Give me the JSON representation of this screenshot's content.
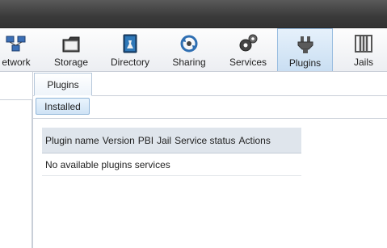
{
  "toolbar": {
    "items": [
      {
        "label": "etwork",
        "icon": "network-icon"
      },
      {
        "label": "Storage",
        "icon": "storage-icon"
      },
      {
        "label": "Directory",
        "icon": "directory-icon"
      },
      {
        "label": "Sharing",
        "icon": "sharing-icon"
      },
      {
        "label": "Services",
        "icon": "services-icon"
      },
      {
        "label": "Plugins",
        "icon": "plugins-icon",
        "active": true
      },
      {
        "label": "Jails",
        "icon": "jails-icon"
      }
    ]
  },
  "tabs": {
    "main_tab": "Plugins",
    "sub_tab": "Installed"
  },
  "table": {
    "columns": [
      "Plugin name",
      "Version",
      "PBI",
      "Jail",
      "Service status",
      "Actions"
    ],
    "empty_message": "No available plugins services"
  },
  "colors": {
    "topbar": "#3a3a3a",
    "active_tab_bg": "#c9def2",
    "grid_header_bg": "#dfe5ec"
  }
}
